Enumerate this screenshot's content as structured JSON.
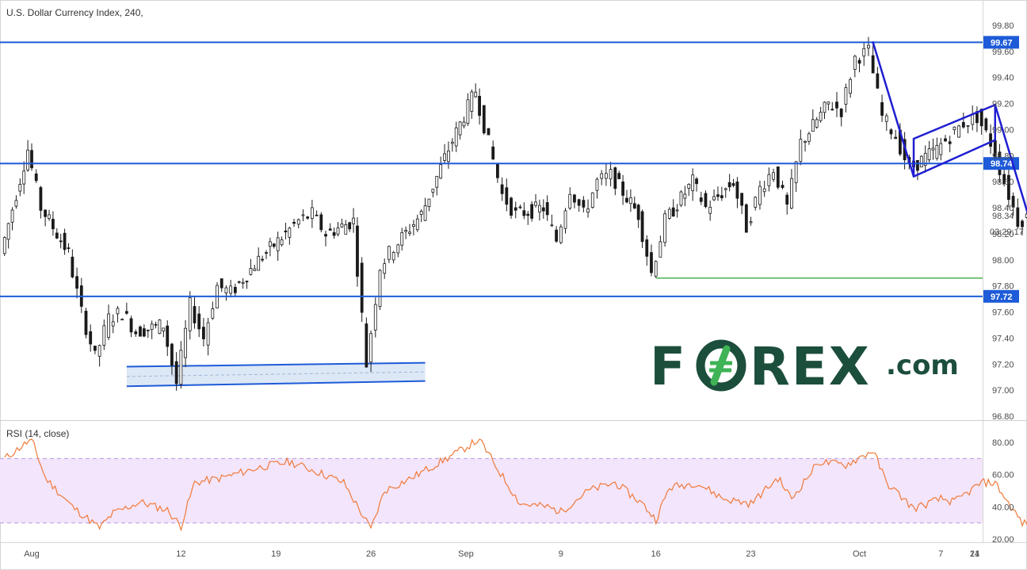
{
  "chart_data": [
    {
      "type": "candlestick",
      "title": "U.S. Dollar Currency Index, 240,",
      "y_ticks": [
        "99.80",
        "99.60",
        "99.40",
        "99.20",
        "99.00",
        "98.80",
        "98.60",
        "98.40",
        "98.20",
        "98.00",
        "97.80",
        "97.60",
        "97.40",
        "97.20",
        "97.00",
        "96.80"
      ],
      "x_ticks": [
        "Aug",
        "12",
        "19",
        "26",
        "Sep",
        "9",
        "16",
        "23",
        "Oct",
        "7",
        "14",
        "21"
      ],
      "ylim": [
        96.8,
        99.8
      ],
      "x_range": [
        "2019-08-01",
        "2019-10-21"
      ],
      "grid": false,
      "price_series": [
        {
          "date": "2019-07-30",
          "price": 98.05
        },
        {
          "date": "2019-08-01",
          "price": 98.85
        },
        {
          "date": "2019-08-02",
          "price": 98.4
        },
        {
          "date": "2019-08-04",
          "price": 98.05
        },
        {
          "date": "2019-08-05",
          "price": 97.6
        },
        {
          "date": "2019-08-06",
          "price": 97.25
        },
        {
          "date": "2019-08-07",
          "price": 97.55
        },
        {
          "date": "2019-08-08",
          "price": 97.6
        },
        {
          "date": "2019-08-09",
          "price": 97.45
        },
        {
          "date": "2019-08-11",
          "price": 97.5
        },
        {
          "date": "2019-08-12",
          "price": 97.05
        },
        {
          "date": "2019-08-13",
          "price": 97.65
        },
        {
          "date": "2019-08-14",
          "price": 97.4
        },
        {
          "date": "2019-08-15",
          "price": 97.8
        },
        {
          "date": "2019-08-16",
          "price": 97.75
        },
        {
          "date": "2019-08-18",
          "price": 98.0
        },
        {
          "date": "2019-08-20",
          "price": 98.2
        },
        {
          "date": "2019-08-21",
          "price": 98.3
        },
        {
          "date": "2019-08-22",
          "price": 98.35
        },
        {
          "date": "2019-08-23",
          "price": 98.2
        },
        {
          "date": "2019-08-25",
          "price": 98.3
        },
        {
          "date": "2019-08-26",
          "price": 97.2
        },
        {
          "date": "2019-08-27",
          "price": 97.95
        },
        {
          "date": "2019-08-28",
          "price": 98.1
        },
        {
          "date": "2019-08-30",
          "price": 98.35
        },
        {
          "date": "2019-09-01",
          "price": 98.85
        },
        {
          "date": "2019-09-03",
          "price": 99.3
        },
        {
          "date": "2019-09-04",
          "price": 98.9
        },
        {
          "date": "2019-09-05",
          "price": 98.5
        },
        {
          "date": "2019-09-06",
          "price": 98.35
        },
        {
          "date": "2019-09-08",
          "price": 98.4
        },
        {
          "date": "2019-09-09",
          "price": 98.15
        },
        {
          "date": "2019-09-10",
          "price": 98.55
        },
        {
          "date": "2019-09-11",
          "price": 98.35
        },
        {
          "date": "2019-09-12",
          "price": 98.6
        },
        {
          "date": "2019-09-13",
          "price": 98.65
        },
        {
          "date": "2019-09-15",
          "price": 98.35
        },
        {
          "date": "2019-09-16",
          "price": 97.9
        },
        {
          "date": "2019-09-17",
          "price": 98.3
        },
        {
          "date": "2019-09-19",
          "price": 98.6
        },
        {
          "date": "2019-09-20",
          "price": 98.4
        },
        {
          "date": "2019-09-22",
          "price": 98.6
        },
        {
          "date": "2019-09-23",
          "price": 98.25
        },
        {
          "date": "2019-09-24",
          "price": 98.55
        },
        {
          "date": "2019-09-25",
          "price": 98.7
        },
        {
          "date": "2019-09-26",
          "price": 98.4
        },
        {
          "date": "2019-09-27",
          "price": 98.9
        },
        {
          "date": "2019-09-29",
          "price": 99.2
        },
        {
          "date": "2019-09-30",
          "price": 99.15
        },
        {
          "date": "2019-10-01",
          "price": 99.55
        },
        {
          "date": "2019-10-02",
          "price": 99.6
        },
        {
          "date": "2019-10-03",
          "price": 99.1
        },
        {
          "date": "2019-10-04",
          "price": 98.95
        },
        {
          "date": "2019-10-05",
          "price": 98.7
        },
        {
          "date": "2019-10-07",
          "price": 98.85
        },
        {
          "date": "2019-10-08",
          "price": 98.95
        },
        {
          "date": "2019-10-09",
          "price": 99.05
        },
        {
          "date": "2019-10-10",
          "price": 99.1
        },
        {
          "date": "2019-10-11",
          "price": 98.9
        },
        {
          "date": "2019-10-12",
          "price": 98.6
        },
        {
          "date": "2019-10-13",
          "price": 98.3
        },
        {
          "date": "2019-10-14",
          "price": 98.34
        }
      ],
      "horizontal_levels": [
        {
          "value": 99.67,
          "label": "99.67",
          "color": "#1e5bd8"
        },
        {
          "value": 98.74,
          "label": "98.74",
          "color": "#1e5bd8"
        },
        {
          "value": 97.72,
          "label": "97.72",
          "color": "#1e5bd8"
        }
      ],
      "support_line": {
        "value": 97.86,
        "from": "2019-09-16",
        "to": "2019-10-21",
        "color": "#4caf50"
      },
      "support_zone": {
        "from": "2019-08-08",
        "to": "2019-08-30",
        "top": [
          97.18,
          97.21
        ],
        "bottom": [
          97.03,
          97.07
        ],
        "color": "#1e5bd8"
      },
      "flag_pattern": {
        "color": "#1e1ed2",
        "pole": [
          {
            "date": "2019-10-02",
            "value": 99.67
          },
          {
            "date": "2019-10-05",
            "value": 98.64
          }
        ],
        "upper": [
          {
            "date": "2019-10-05",
            "value": 98.93
          },
          {
            "date": "2019-10-11",
            "value": 99.19
          }
        ],
        "lower": [
          {
            "date": "2019-10-05",
            "value": 98.64
          },
          {
            "date": "2019-10-11",
            "value": 98.92
          }
        ],
        "drop": [
          {
            "date": "2019-10-11",
            "value": 99.19
          },
          {
            "date": "2019-10-14",
            "value": 98.15
          }
        ]
      },
      "last_price": "98.34",
      "countdown": "03:29:17"
    },
    {
      "type": "line",
      "title": "RSI (14, close)",
      "y_ticks": [
        "80.00",
        "60.00",
        "40.00",
        "20.00"
      ],
      "ylim": [
        20,
        83
      ],
      "band": [
        30,
        70
      ],
      "band_color": "#f3e5fb",
      "line_color": "#f07a3a",
      "series": [
        {
          "date": "2019-07-30",
          "value": 70
        },
        {
          "date": "2019-08-01",
          "value": 82
        },
        {
          "date": "2019-08-02",
          "value": 58
        },
        {
          "date": "2019-08-04",
          "value": 40
        },
        {
          "date": "2019-08-06",
          "value": 27
        },
        {
          "date": "2019-08-07",
          "value": 36
        },
        {
          "date": "2019-08-09",
          "value": 43
        },
        {
          "date": "2019-08-11",
          "value": 38
        },
        {
          "date": "2019-08-12",
          "value": 28
        },
        {
          "date": "2019-08-13",
          "value": 55
        },
        {
          "date": "2019-08-15",
          "value": 58
        },
        {
          "date": "2019-08-18",
          "value": 65
        },
        {
          "date": "2019-08-20",
          "value": 68
        },
        {
          "date": "2019-08-22",
          "value": 62
        },
        {
          "date": "2019-08-24",
          "value": 55
        },
        {
          "date": "2019-08-26",
          "value": 26
        },
        {
          "date": "2019-08-27",
          "value": 50
        },
        {
          "date": "2019-08-29",
          "value": 58
        },
        {
          "date": "2019-09-01",
          "value": 72
        },
        {
          "date": "2019-09-03",
          "value": 82
        },
        {
          "date": "2019-09-04",
          "value": 68
        },
        {
          "date": "2019-09-06",
          "value": 42
        },
        {
          "date": "2019-09-08",
          "value": 40
        },
        {
          "date": "2019-09-09",
          "value": 37
        },
        {
          "date": "2019-09-11",
          "value": 50
        },
        {
          "date": "2019-09-13",
          "value": 55
        },
        {
          "date": "2019-09-15",
          "value": 42
        },
        {
          "date": "2019-09-16",
          "value": 32
        },
        {
          "date": "2019-09-17",
          "value": 52
        },
        {
          "date": "2019-09-19",
          "value": 55
        },
        {
          "date": "2019-09-21",
          "value": 45
        },
        {
          "date": "2019-09-23",
          "value": 42
        },
        {
          "date": "2019-09-25",
          "value": 58
        },
        {
          "date": "2019-09-26",
          "value": 45
        },
        {
          "date": "2019-09-28",
          "value": 68
        },
        {
          "date": "2019-09-30",
          "value": 66
        },
        {
          "date": "2019-10-02",
          "value": 75
        },
        {
          "date": "2019-10-03",
          "value": 55
        },
        {
          "date": "2019-10-05",
          "value": 39
        },
        {
          "date": "2019-10-07",
          "value": 45
        },
        {
          "date": "2019-10-08",
          "value": 43
        },
        {
          "date": "2019-10-10",
          "value": 55
        },
        {
          "date": "2019-10-11",
          "value": 55
        },
        {
          "date": "2019-10-12",
          "value": 42
        },
        {
          "date": "2019-10-13",
          "value": 30
        },
        {
          "date": "2019-10-14",
          "value": 28
        }
      ]
    }
  ],
  "logo": {
    "text": "F0REX.com"
  }
}
